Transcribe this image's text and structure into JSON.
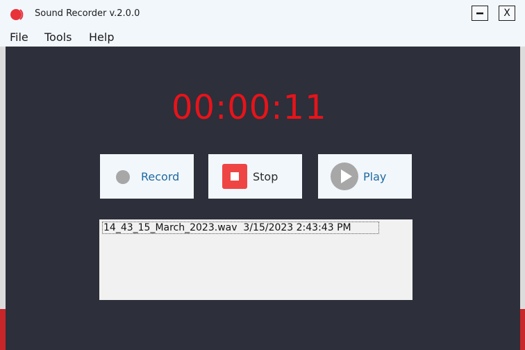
{
  "window": {
    "title": "Sound Recorder v.2.0.0",
    "minimize_label": "—",
    "close_label": "X"
  },
  "menu": {
    "items": [
      "File",
      "Tools",
      "Help"
    ]
  },
  "timer": {
    "display": "00:00:11"
  },
  "controls": {
    "record_label": "Record",
    "stop_label": "Stop",
    "play_label": "Play"
  },
  "recordings": [
    {
      "entry": "14_43_15_March_2023.wav  3/15/2023 2:43:43 PM"
    }
  ],
  "colors": {
    "accent_red": "#e8131a",
    "stop_red": "#ef4444",
    "background_dark": "#2d2f3a",
    "button_bg": "#f2f7fc",
    "label_blue": "#1e6aa0"
  },
  "icons": [
    "app-logo-icon",
    "record-dot-icon",
    "stop-square-icon",
    "play-triangle-icon"
  ]
}
